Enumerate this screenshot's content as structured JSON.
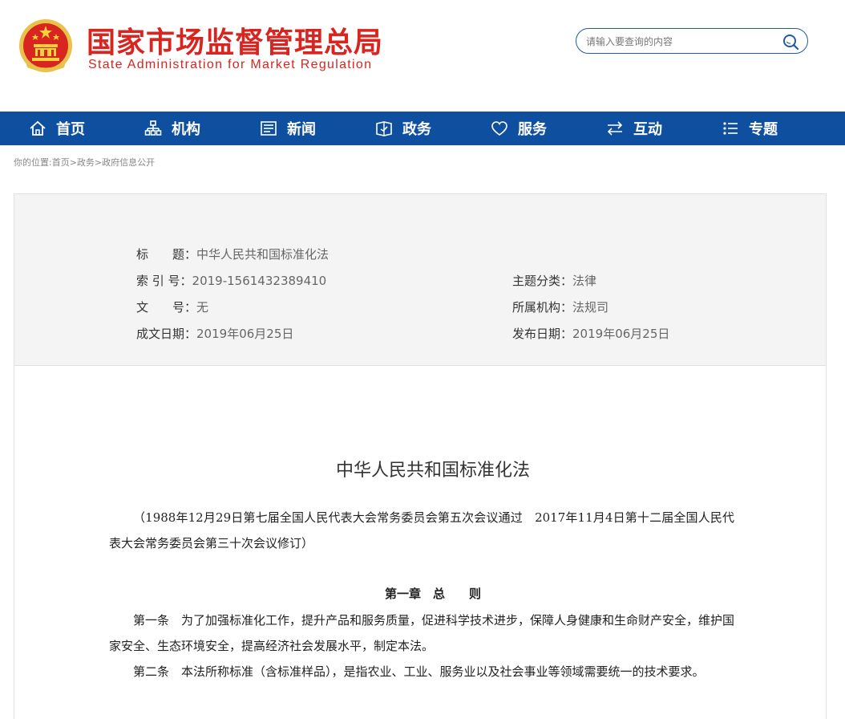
{
  "header": {
    "name_cn": "国家市场监督管理总局",
    "name_en": "State Administration for Market Regulation",
    "search_placeholder": "请输入要查询的内容"
  },
  "nav": {
    "items": [
      {
        "label": "首页",
        "icon": "home-icon"
      },
      {
        "label": "机构",
        "icon": "org-icon"
      },
      {
        "label": "新闻",
        "icon": "news-icon"
      },
      {
        "label": "政务",
        "icon": "affairs-icon"
      },
      {
        "label": "服务",
        "icon": "heart-icon"
      },
      {
        "label": "互动",
        "icon": "exchange-icon"
      },
      {
        "label": "专题",
        "icon": "topic-list-icon"
      }
    ]
  },
  "breadcrumb": "你的位置:首页>政务>政府信息公开",
  "info": {
    "title_label": "标　　题：",
    "title_value": "中华人民共和国标准化法",
    "index_label": "索 引 号：",
    "index_value": "2019-1561432389410",
    "category_label": "主题分类：",
    "category_value": "法律",
    "docno_label": "文　　号：",
    "docno_value": "无",
    "org_label": "所属机构：",
    "org_value": "法规司",
    "created_label": "成文日期：",
    "created_value": "2019年06月25日",
    "published_label": "发布日期：",
    "published_value": "2019年06月25日"
  },
  "document": {
    "title": "中华人民共和国标准化法",
    "intro": "（1988年12月29日第七届全国人民代表大会常务委员会第五次会议通过　2017年11月4日第十二届全国人民代表大会常务委员会第三十次会议修订）",
    "chapter1": "第一章　总　　则",
    "article1": "第一条　为了加强标准化工作，提升产品和服务质量，促进科学技术进步，保障人身健康和生命财产安全，维护国家安全、生态环境安全，提高经济社会发展水平，制定本法。",
    "article2": "第二条　本法所称标准（含标准样品），是指农业、工业、服务业以及社会事业等领域需要统一的技术要求。"
  },
  "colors": {
    "brand_red": "#d8251f",
    "nav_blue": "#0f4fa0"
  }
}
